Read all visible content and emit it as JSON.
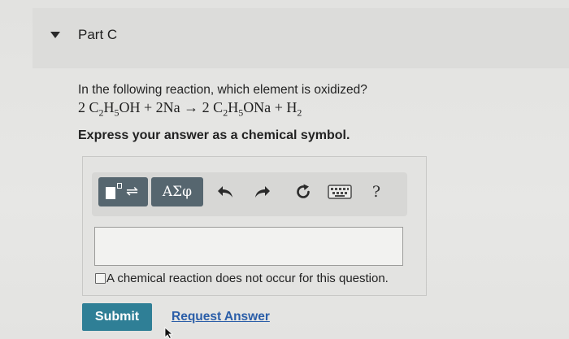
{
  "section": {
    "title": "Part C"
  },
  "question": {
    "prompt": "In the following reaction, which element is oxidized?",
    "equation": {
      "lhs_coef_1": "2",
      "lhs_species_1": [
        "C",
        "2",
        "H",
        "5",
        "OH"
      ],
      "plus_1": "+",
      "lhs_coef_2": "2",
      "lhs_species_2": "Na",
      "arrow": "→",
      "rhs_coef_1": "2",
      "rhs_species_1": [
        "C",
        "2",
        "H",
        "5",
        "ONa"
      ],
      "plus_2": "+",
      "rhs_species_2": [
        "H",
        "2"
      ]
    },
    "instruction": "Express your answer as a chemical symbol."
  },
  "toolbar": {
    "templates_icon": "templates-icon",
    "greek_label": "ΑΣφ",
    "undo_icon": "undo-icon",
    "redo_icon": "redo-icon",
    "reset_icon": "reset-icon",
    "keyboard_icon": "keyboard-icon",
    "help_label": "?"
  },
  "answer": {
    "value": "",
    "no_reaction_checked": false,
    "no_reaction_label": "A chemical reaction does not occur for this question."
  },
  "actions": {
    "submit_label": "Submit",
    "request_answer_label": "Request Answer"
  },
  "colors": {
    "submit_bg": "#2f7f96",
    "tool_button_bg": "#56666f",
    "link": "#2b5ea8"
  }
}
